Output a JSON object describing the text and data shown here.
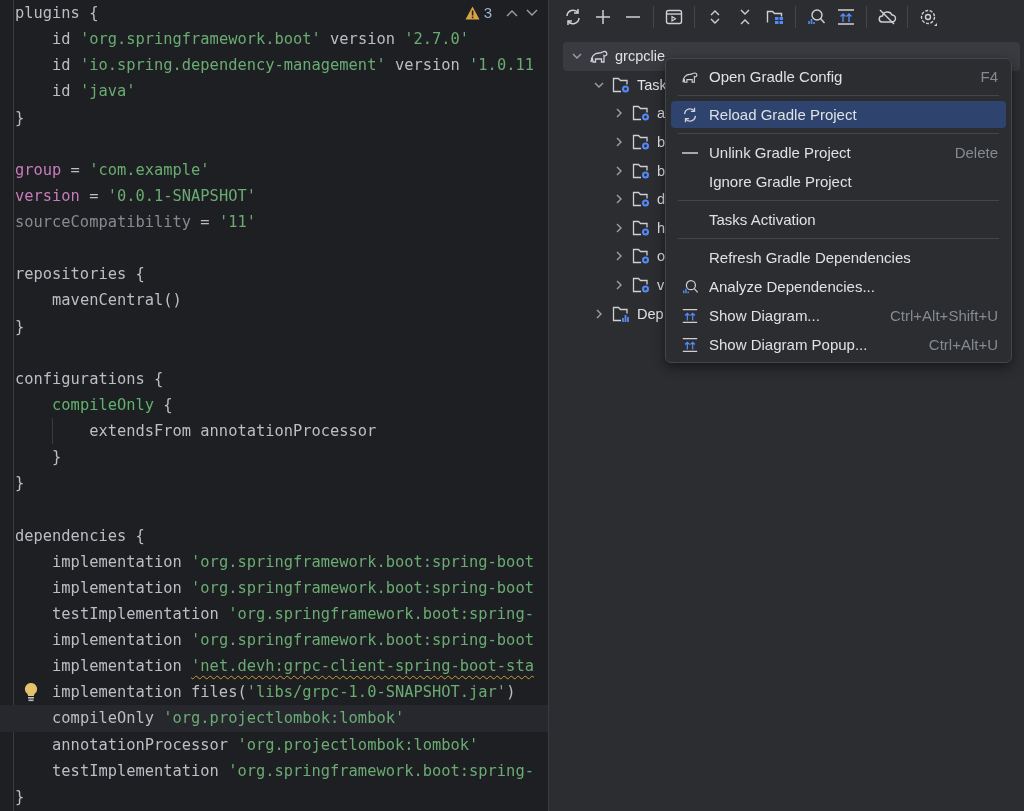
{
  "editor": {
    "warnings": {
      "count": "3"
    },
    "lines": [
      {
        "tokens": [
          {
            "kind": "plain",
            "text": "plugins {"
          }
        ]
      },
      {
        "tokens": [
          {
            "kind": "plain",
            "text": "    id "
          },
          {
            "kind": "string",
            "text": "'org.springframework.boot'"
          },
          {
            "kind": "plain",
            "text": " version "
          },
          {
            "kind": "string",
            "text": "'2.7.0'"
          }
        ]
      },
      {
        "tokens": [
          {
            "kind": "plain",
            "text": "    id "
          },
          {
            "kind": "string",
            "text": "'io.spring.dependency-management'"
          },
          {
            "kind": "plain",
            "text": " version "
          },
          {
            "kind": "string",
            "text": "'1.0.11"
          }
        ]
      },
      {
        "tokens": [
          {
            "kind": "plain",
            "text": "    id "
          },
          {
            "kind": "string",
            "text": "'java'"
          }
        ]
      },
      {
        "tokens": [
          {
            "kind": "plain",
            "text": "}"
          }
        ]
      },
      {
        "blank": true
      },
      {
        "tokens": [
          {
            "kind": "property",
            "text": "group"
          },
          {
            "kind": "plain",
            "text": " = "
          },
          {
            "kind": "string",
            "text": "'com.example'"
          }
        ]
      },
      {
        "tokens": [
          {
            "kind": "property",
            "text": "version"
          },
          {
            "kind": "plain",
            "text": " = "
          },
          {
            "kind": "string",
            "text": "'0.0.1-SNAPSHOT'"
          }
        ]
      },
      {
        "tokens": [
          {
            "kind": "dim",
            "text": "sourceCompatibility"
          },
          {
            "kind": "plain",
            "text": " = "
          },
          {
            "kind": "string",
            "text": "'11'"
          }
        ]
      },
      {
        "blank": true
      },
      {
        "tokens": [
          {
            "kind": "plain",
            "text": "repositories {"
          }
        ]
      },
      {
        "tokens": [
          {
            "kind": "plain",
            "text": "    mavenCentral()"
          }
        ]
      },
      {
        "tokens": [
          {
            "kind": "plain",
            "text": "}"
          }
        ]
      },
      {
        "blank": true
      },
      {
        "tokens": [
          {
            "kind": "plain",
            "text": "configurations {"
          }
        ]
      },
      {
        "tokens": [
          {
            "kind": "method",
            "text": "    compileOnly"
          },
          {
            "kind": "plain",
            "text": " {"
          }
        ]
      },
      {
        "guide": true,
        "tokens": [
          {
            "kind": "plain",
            "text": "        extendsFrom annotationProcessor"
          }
        ]
      },
      {
        "tokens": [
          {
            "kind": "plain",
            "text": "    }"
          }
        ]
      },
      {
        "tokens": [
          {
            "kind": "plain",
            "text": "}"
          }
        ]
      },
      {
        "blank": true
      },
      {
        "tokens": [
          {
            "kind": "plain",
            "text": "dependencies {"
          }
        ]
      },
      {
        "tokens": [
          {
            "kind": "plain",
            "text": "    implementation "
          },
          {
            "kind": "string",
            "text": "'org.springframework.boot:spring-boot"
          }
        ]
      },
      {
        "tokens": [
          {
            "kind": "plain",
            "text": "    implementation "
          },
          {
            "kind": "string",
            "text": "'org.springframework.boot:spring-boot"
          }
        ]
      },
      {
        "tokens": [
          {
            "kind": "plain",
            "text": "    testImplementation "
          },
          {
            "kind": "string",
            "text": "'org.springframework.boot:spring-"
          }
        ]
      },
      {
        "tokens": [
          {
            "kind": "plain",
            "text": "    implementation "
          },
          {
            "kind": "string",
            "text": "'org.springframework.boot:spring-boot"
          }
        ]
      },
      {
        "tokens": [
          {
            "kind": "plain",
            "text": "    implementation "
          },
          {
            "kind": "string",
            "text": "'net.devh:grpc-client-spring-boot-sta",
            "warning": true
          }
        ]
      },
      {
        "bulb": true,
        "tokens": [
          {
            "kind": "plain",
            "text": "    implementation files("
          },
          {
            "kind": "string",
            "text": "'libs/grpc-1.0-SNAPSHOT.jar'"
          },
          {
            "kind": "plain",
            "text": ")"
          }
        ]
      },
      {
        "current": true,
        "tokens": [
          {
            "kind": "plain",
            "text": "    compileOnly "
          },
          {
            "kind": "string",
            "text": "'org.projectlombok:lombok'"
          }
        ]
      },
      {
        "tokens": [
          {
            "kind": "plain",
            "text": "    annotationProcessor "
          },
          {
            "kind": "string",
            "text": "'org.projectlombok:lombok'"
          }
        ]
      },
      {
        "tokens": [
          {
            "kind": "plain",
            "text": "    testImplementation "
          },
          {
            "kind": "string",
            "text": "'org.springframework.boot:spring-"
          }
        ]
      },
      {
        "tokens": [
          {
            "kind": "plain",
            "text": "}"
          }
        ]
      }
    ]
  },
  "gradle_tree": [
    {
      "kind": "project",
      "label": "grcpclie",
      "expanded": true,
      "selected": true,
      "children": [
        {
          "kind": "tasks",
          "label": "Task",
          "expanded": true,
          "selected": false,
          "children": [
            {
              "kind": "task-group",
              "label": "a",
              "expanded": false,
              "selected": false
            },
            {
              "kind": "task-group",
              "label": "b",
              "expanded": false,
              "selected": false
            },
            {
              "kind": "task-group",
              "label": "b",
              "expanded": false,
              "selected": false
            },
            {
              "kind": "task-group",
              "label": "d",
              "expanded": false,
              "selected": false
            },
            {
              "kind": "task-group",
              "label": "h",
              "expanded": false,
              "selected": false
            },
            {
              "kind": "task-group",
              "label": "o",
              "expanded": false,
              "selected": false
            },
            {
              "kind": "task-group",
              "label": "v",
              "expanded": false,
              "selected": false
            }
          ]
        },
        {
          "kind": "dependencies",
          "label": "Dep",
          "expanded": false,
          "selected": false
        }
      ]
    }
  ],
  "context_menu": [
    {
      "kind": "item",
      "label": "Open Gradle Config",
      "shortcut": "F4",
      "selected": false
    },
    {
      "kind": "separator"
    },
    {
      "kind": "item",
      "label": "Reload Gradle Project",
      "selected": true
    },
    {
      "kind": "separator"
    },
    {
      "kind": "item",
      "label": "Unlink Gradle Project",
      "shortcut": "Delete",
      "selected": false
    },
    {
      "kind": "item",
      "label": "Ignore Gradle Project",
      "selected": false
    },
    {
      "kind": "separator"
    },
    {
      "kind": "item",
      "label": "Tasks Activation",
      "selected": false
    },
    {
      "kind": "separator"
    },
    {
      "kind": "item",
      "label": "Refresh Gradle Dependencies",
      "selected": false
    },
    {
      "kind": "item",
      "label": "Analyze Dependencies...",
      "selected": false
    },
    {
      "kind": "item",
      "label": "Show Diagram...",
      "shortcut": "Ctrl+Alt+Shift+U",
      "selected": false
    },
    {
      "kind": "item",
      "label": "Show Diagram Popup...",
      "shortcut": "Ctrl+Alt+U",
      "selected": false
    }
  ]
}
